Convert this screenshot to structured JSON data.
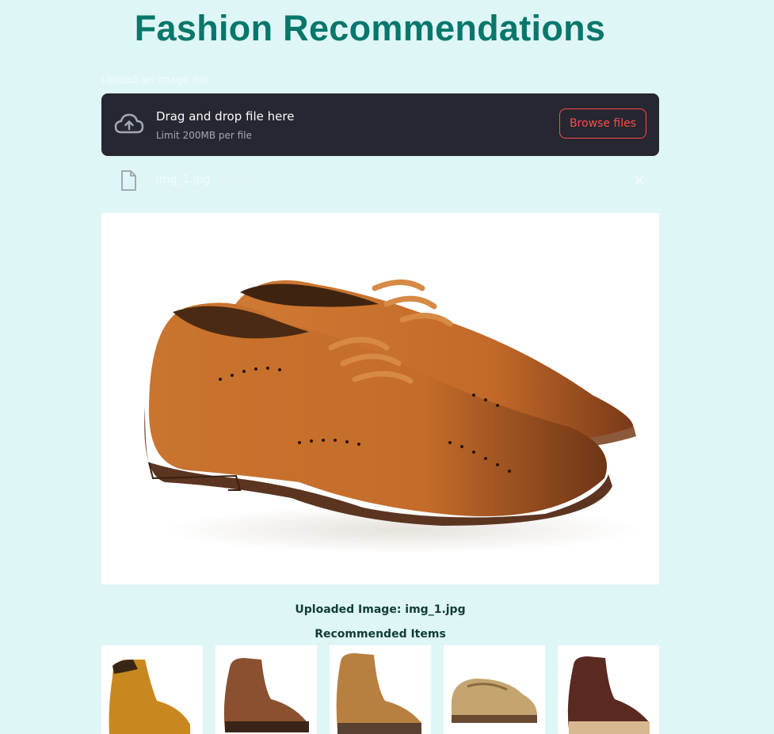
{
  "page": {
    "title": "Fashion Recommendations"
  },
  "uploader": {
    "label": "Upload an image file",
    "drop_text": "Drag and drop file here",
    "limit_text": "Limit 200MB per file",
    "browse_label": "Browse files",
    "icon": "cloud-upload-icon"
  },
  "file": {
    "name": "img_1.jpg",
    "size": "0.2MB",
    "icon": "file-icon"
  },
  "captions": {
    "uploaded": "Uploaded Image: img_1.jpg",
    "recommended": "Recommended Items"
  },
  "recommendations": [
    {
      "description": "tan lace-up work boot"
    },
    {
      "description": "brown leather chukka boot"
    },
    {
      "description": "tan suede lace-up boot"
    },
    {
      "description": "beige suede moccasin shoe"
    },
    {
      "description": "dark brown leather boot"
    }
  ],
  "colors": {
    "accent": "#ff4b4b",
    "title": "#08776b",
    "background": "#dff6f7"
  }
}
